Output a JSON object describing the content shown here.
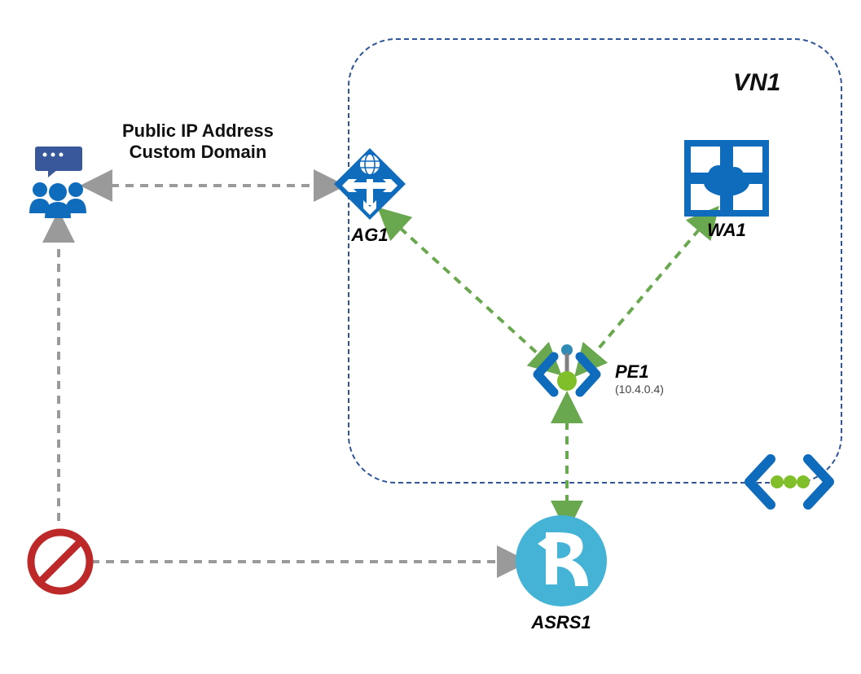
{
  "vnet": {
    "label": "VN1"
  },
  "nodes": {
    "users": {
      "name": "users-icon"
    },
    "ag1": {
      "label": "AG1",
      "name": "application-gateway-icon"
    },
    "wa1": {
      "label": "WA1",
      "name": "web-app-icon"
    },
    "pe1": {
      "label": "PE1",
      "ip": "(10.4.0.4)",
      "name": "private-endpoint-icon"
    },
    "asrs1": {
      "label": "ASRS1",
      "name": "signalr-service-icon"
    },
    "block": {
      "name": "blocked-icon"
    },
    "vnetBadge": {
      "name": "virtual-network-icon"
    }
  },
  "connectors": {
    "usersToAg1": {
      "line1": "Public IP Address",
      "line2": "Custom Domain"
    }
  },
  "palette": {
    "azureBlue": "#0f6cbd",
    "green": "#6aa84f",
    "vnBorder": "#2f5597",
    "gray": "#9a9a9a",
    "red": "#bd2929",
    "cyan": "#44b3d6"
  }
}
